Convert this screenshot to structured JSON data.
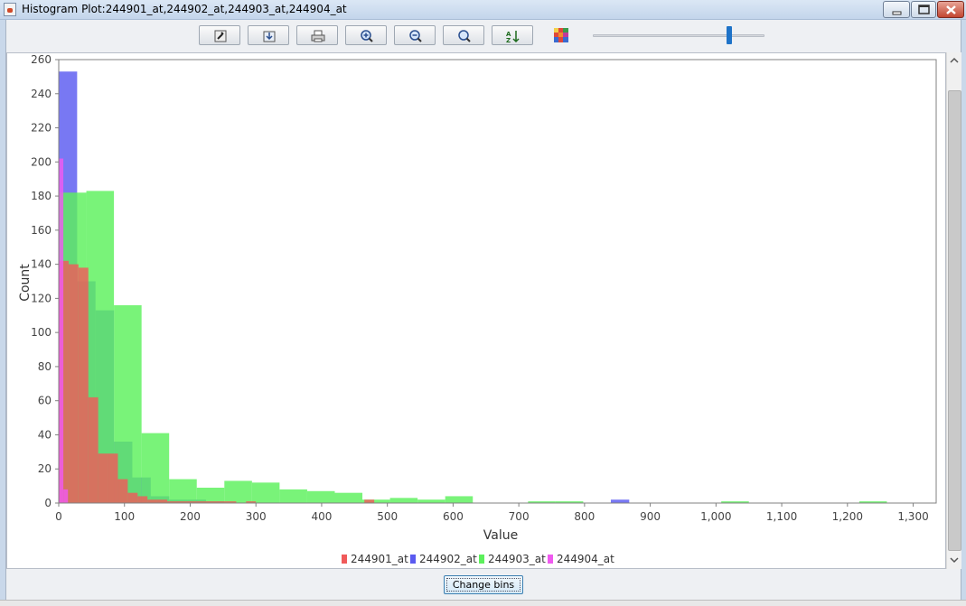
{
  "window": {
    "title": "Histogram Plot:244901_at,244902_at,244903_at,244904_at",
    "controls": [
      "minimize-icon",
      "maximize-icon",
      "close-icon"
    ]
  },
  "toolbar": {
    "buttons": [
      {
        "name": "properties-button",
        "icon": "wrench-icon"
      },
      {
        "name": "export-button",
        "icon": "export-icon"
      },
      {
        "name": "print-button",
        "icon": "print-icon"
      },
      {
        "name": "zoom-in-button",
        "icon": "zoom-in-icon"
      },
      {
        "name": "zoom-out-button",
        "icon": "zoom-out-icon"
      },
      {
        "name": "zoom-reset-button",
        "icon": "magnifier-icon"
      },
      {
        "name": "sort-button",
        "icon": "sort-az-icon"
      }
    ],
    "palette_icon": "color-palette-icon",
    "transparency_slider": {
      "value": 0.81
    }
  },
  "change_bins_label": "Change bins",
  "colors": {
    "244901_at": "#f05a5a",
    "244902_at": "#5a5af0",
    "244903_at": "#5cf05c",
    "244904_at": "#f05af0"
  },
  "chart_data": {
    "type": "histogram",
    "title": "",
    "xlabel": "Value",
    "ylabel": "Count",
    "xlim": [
      0,
      1335
    ],
    "ylim": [
      0,
      260
    ],
    "xticks": [
      0,
      100,
      200,
      300,
      400,
      500,
      600,
      700,
      800,
      900,
      1000,
      1100,
      1200,
      1300
    ],
    "xtick_labels": [
      "0",
      "100",
      "200",
      "300",
      "400",
      "500",
      "600",
      "700",
      "800",
      "900",
      "1,000",
      "1,100",
      "1,200",
      "1,300"
    ],
    "yticks": [
      0,
      20,
      40,
      60,
      80,
      100,
      120,
      140,
      160,
      180,
      200,
      220,
      240,
      260
    ],
    "legend_position": "bottom-center",
    "grid": false,
    "series": [
      {
        "name": "244902_at",
        "bin_width": 28,
        "bins": [
          [
            0,
            253
          ],
          [
            28,
            130
          ],
          [
            56,
            113
          ],
          [
            84,
            36
          ],
          [
            112,
            15
          ],
          [
            140,
            4
          ],
          [
            168,
            2
          ],
          [
            196,
            2
          ],
          [
            224,
            1
          ],
          [
            840,
            2
          ]
        ]
      },
      {
        "name": "244903_at",
        "bin_width": 42,
        "bins": [
          [
            0,
            182
          ],
          [
            42,
            183
          ],
          [
            84,
            116
          ],
          [
            126,
            41
          ],
          [
            168,
            14
          ],
          [
            210,
            9
          ],
          [
            252,
            13
          ],
          [
            294,
            12
          ],
          [
            336,
            8
          ],
          [
            378,
            7
          ],
          [
            420,
            6
          ],
          [
            462,
            2
          ],
          [
            504,
            3
          ],
          [
            546,
            2
          ],
          [
            588,
            4
          ],
          [
            630,
            0
          ],
          [
            672,
            0
          ],
          [
            714,
            1
          ],
          [
            756,
            1
          ],
          [
            1008,
            1
          ],
          [
            1218,
            1
          ]
        ]
      },
      {
        "name": "244901_at",
        "bin_width": 15,
        "bins": [
          [
            0,
            142
          ],
          [
            15,
            140
          ],
          [
            30,
            138
          ],
          [
            45,
            62
          ],
          [
            60,
            29
          ],
          [
            75,
            29
          ],
          [
            90,
            14
          ],
          [
            105,
            6
          ],
          [
            120,
            4
          ],
          [
            135,
            2
          ],
          [
            150,
            2
          ],
          [
            165,
            1
          ],
          [
            180,
            1
          ],
          [
            195,
            1
          ],
          [
            210,
            1
          ],
          [
            225,
            1
          ],
          [
            240,
            1
          ],
          [
            255,
            1
          ],
          [
            270,
            0
          ],
          [
            285,
            1
          ],
          [
            465,
            2
          ]
        ]
      },
      {
        "name": "244904_at",
        "bin_width": 7,
        "bins": [
          [
            0,
            202
          ],
          [
            7,
            8
          ]
        ]
      }
    ]
  }
}
